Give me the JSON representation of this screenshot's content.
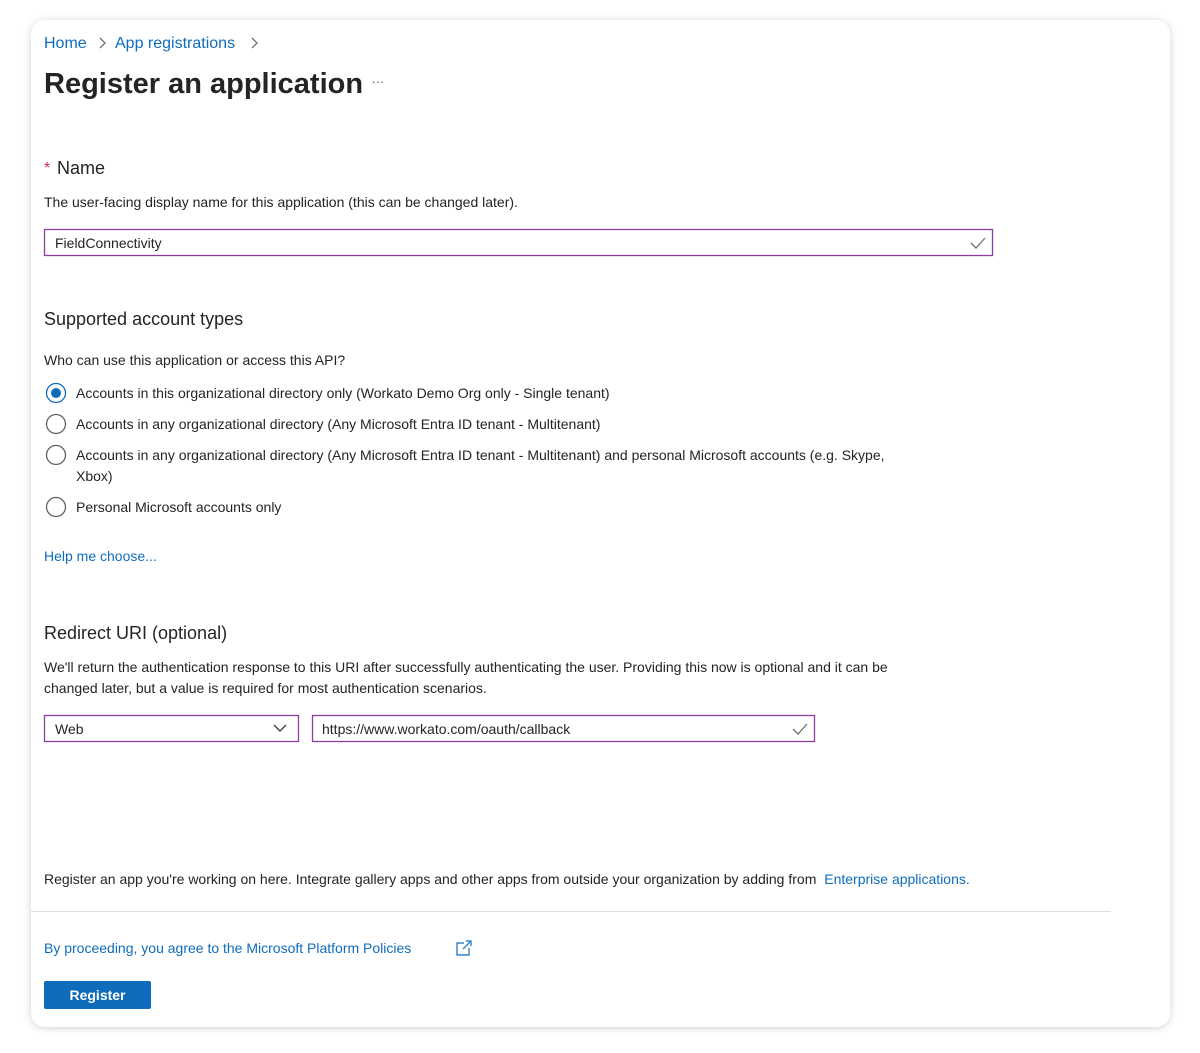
{
  "breadcrumb": {
    "home": "Home",
    "app_registrations": "App registrations"
  },
  "page": {
    "title": "Register an application",
    "more_menu": "···"
  },
  "name_section": {
    "required_marker": "*",
    "label": "Name",
    "description": "The user-facing display name for this application (this can be changed later).",
    "input_value": "FieldConnectivity"
  },
  "account_types": {
    "heading": "Supported account types",
    "question": "Who can use this application or access this API?",
    "options": [
      {
        "label": "Accounts in this organizational directory only (Workato Demo Org only - Single tenant)",
        "selected": true
      },
      {
        "label": "Accounts in any organizational directory (Any Microsoft Entra ID tenant - Multitenant)",
        "selected": false
      },
      {
        "label_line1": "Accounts in any organizational directory (Any Microsoft Entra ID tenant - Multitenant) and personal Microsoft accounts (e.g. Skype,",
        "label_line2": "Xbox)",
        "selected": false
      },
      {
        "label": "Personal Microsoft accounts only",
        "selected": false
      }
    ],
    "help_link": "Help me choose..."
  },
  "redirect": {
    "heading": "Redirect URI (optional)",
    "description_line1": "We'll return the authentication response to this URI after successfully authenticating the user. Providing this now is optional and it can be",
    "description_line2": "changed later, but a value is required for most authentication scenarios.",
    "platform_value": "Web",
    "uri_value": "https://www.workato.com/oauth/callback"
  },
  "footer": {
    "note": "Register an app you're working on here. Integrate gallery apps and other apps from outside your organization by adding from",
    "note_link": "Enterprise applications.",
    "policy_link": "By proceeding, you agree to the Microsoft Platform Policies",
    "register_button": "Register"
  },
  "colors": {
    "accent": "#0f6cbd",
    "input_border": "#8a3f9e",
    "text": "#242424"
  }
}
